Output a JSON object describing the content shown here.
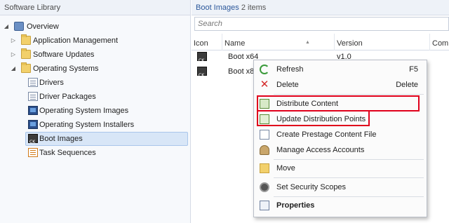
{
  "left_pane": {
    "title": "Software Library",
    "tree": [
      {
        "label": "Overview",
        "icon": "overview-icon",
        "expand": "collapse-arrow"
      },
      {
        "label": "Application Management",
        "icon": "folder-icon",
        "expand": "expand-arrow"
      },
      {
        "label": "Software Updates",
        "icon": "folder-icon",
        "expand": "expand-arrow"
      },
      {
        "label": "Operating Systems",
        "icon": "folder-icon",
        "expand": "collapse-arrow"
      },
      {
        "label": "Drivers",
        "icon": "drivers-icon"
      },
      {
        "label": "Driver Packages",
        "icon": "driver-packages-icon"
      },
      {
        "label": "Operating System Images",
        "icon": "os-images-icon"
      },
      {
        "label": "Operating System Installers",
        "icon": "os-installers-icon"
      },
      {
        "label": "Boot Images",
        "icon": "boot-images-icon",
        "selected": true
      },
      {
        "label": "Task Sequences",
        "icon": "task-sequences-icon"
      }
    ]
  },
  "right_pane": {
    "title": "Boot Images",
    "count": "2 items",
    "search_placeholder": "Search",
    "columns": [
      "Icon",
      "Name",
      "Version",
      "Comm"
    ],
    "rows": [
      {
        "name": "Boot x64",
        "version": "v1.0"
      },
      {
        "name": "Boot x8",
        "version": ""
      }
    ]
  },
  "context_menu": {
    "items": [
      {
        "label": "Refresh",
        "shortcut": "F5",
        "icon": "refresh-icon"
      },
      {
        "label": "Delete",
        "shortcut": "Delete",
        "icon": "delete-icon"
      },
      {
        "label": "Distribute Content",
        "shortcut": "",
        "icon": "distribute-content-icon",
        "highlighted": true
      },
      {
        "label": "Update Distribution Points",
        "shortcut": "",
        "icon": "update-distribution-points-icon",
        "highlighted": true
      },
      {
        "label": "Create Prestage Content File",
        "shortcut": "",
        "icon": "prestage-content-icon"
      },
      {
        "label": "Manage Access Accounts",
        "shortcut": "",
        "icon": "access-accounts-icon"
      },
      {
        "label": "Move",
        "shortcut": "",
        "icon": "move-icon"
      },
      {
        "label": "Set Security Scopes",
        "shortcut": "",
        "icon": "security-scopes-icon"
      },
      {
        "label": "Properties",
        "shortcut": "",
        "icon": "properties-icon",
        "bold": true
      }
    ],
    "highlight_color": "#e0001b"
  },
  "colors": {
    "accent": "#2b579a",
    "selection": "#d8e6f7"
  }
}
